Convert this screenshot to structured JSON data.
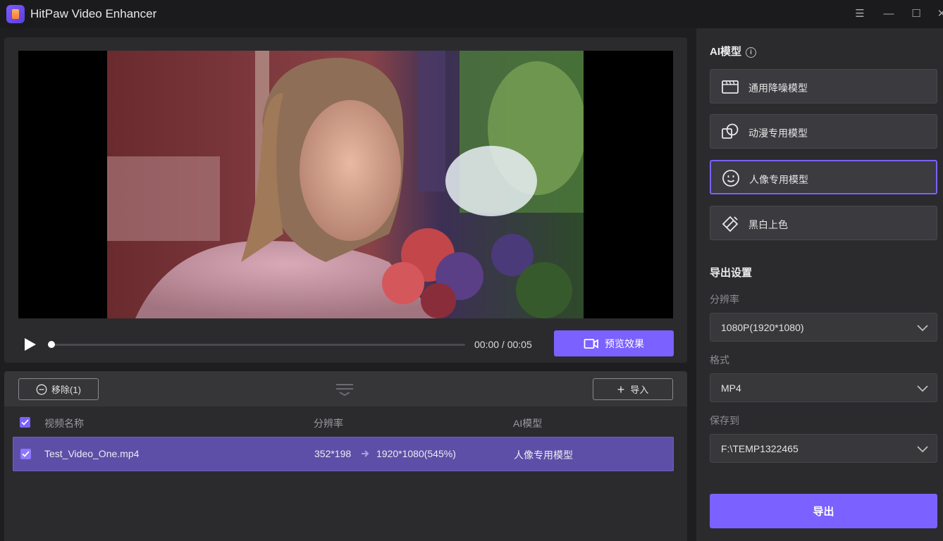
{
  "app": {
    "title": "HitPaw Video Enhancer"
  },
  "window_controls": {
    "menu": "☰",
    "minimize": "—",
    "maximize": "☐",
    "close": "✕"
  },
  "player": {
    "time": "00:00 / 00:05",
    "progress": 0,
    "preview_label": "预览效果"
  },
  "list": {
    "remove_label": "移除(1)",
    "import_label": "导入",
    "columns": {
      "name": "视频名称",
      "resolution": "分辨率",
      "model": "AI模型"
    },
    "rows": [
      {
        "name": "Test_Video_One.mp4",
        "from_res": "352*198",
        "to_res": "1920*1080(545%)",
        "model": "人像专用模型",
        "checked": true
      }
    ]
  },
  "right_panel": {
    "ai_model_title": "AI模型",
    "models": [
      {
        "label": "通用降噪模型",
        "icon": "film-icon",
        "active": false
      },
      {
        "label": "动漫专用模型",
        "icon": "anime-icon",
        "active": false
      },
      {
        "label": "人像专用模型",
        "icon": "face-icon",
        "active": true
      },
      {
        "label": "黑白上色",
        "icon": "colorize-icon",
        "active": false
      }
    ],
    "export_settings_title": "导出设置",
    "resolution_label": "分辨率",
    "resolution_value": "1080P(1920*1080)",
    "format_label": "格式",
    "format_value": "MP4",
    "save_label": "保存到",
    "save_value": "F:\\TEMP1322465",
    "export_label": "导出"
  },
  "colors": {
    "accent": "#7b61ff",
    "selected_row": "#5d4fa7",
    "panel": "#2b2b2e",
    "background": "#1e1e20"
  }
}
